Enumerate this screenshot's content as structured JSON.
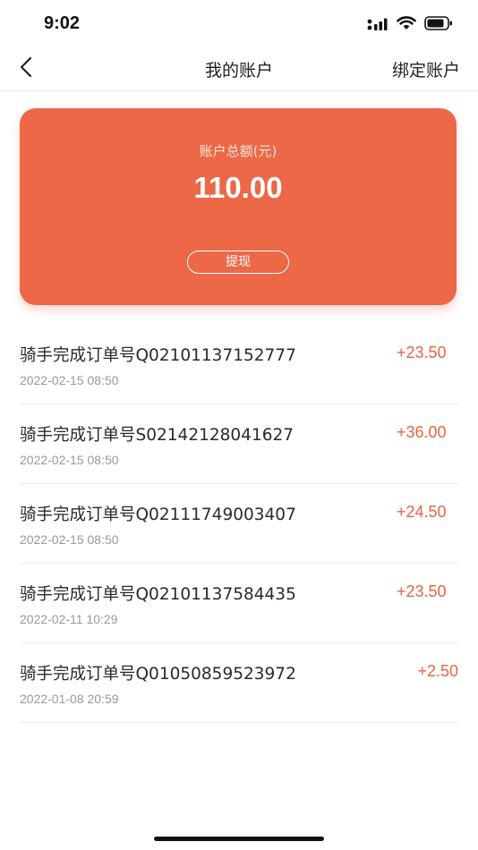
{
  "status_bar": {
    "time": "9:02"
  },
  "nav": {
    "title": "我的账户",
    "right_action": "绑定账户"
  },
  "balance_card": {
    "label": "账户总额(元)",
    "amount": "110.00",
    "withdraw_label": "提现",
    "color": "#ec6846"
  },
  "transactions": [
    {
      "title": "骑手完成订单号Q02101137152777",
      "date": "2022-02-15 08:50",
      "amount": "+23.50"
    },
    {
      "title": "骑手完成订单号S02142128041627",
      "date": "2022-02-15 08:50",
      "amount": "+36.00"
    },
    {
      "title": "骑手完成订单号Q02111749003407",
      "date": "2022-02-15 08:50",
      "amount": "+24.50"
    },
    {
      "title": "骑手完成订单号Q02101137584435",
      "date": "2022-02-11 10:29",
      "amount": "+23.50"
    },
    {
      "title": "骑手完成订单号Q01050859523972",
      "date": "2022-01-08 20:59",
      "amount": "+2.50"
    }
  ],
  "colors": {
    "accent": "#e8643f",
    "card": "#ec6846"
  }
}
